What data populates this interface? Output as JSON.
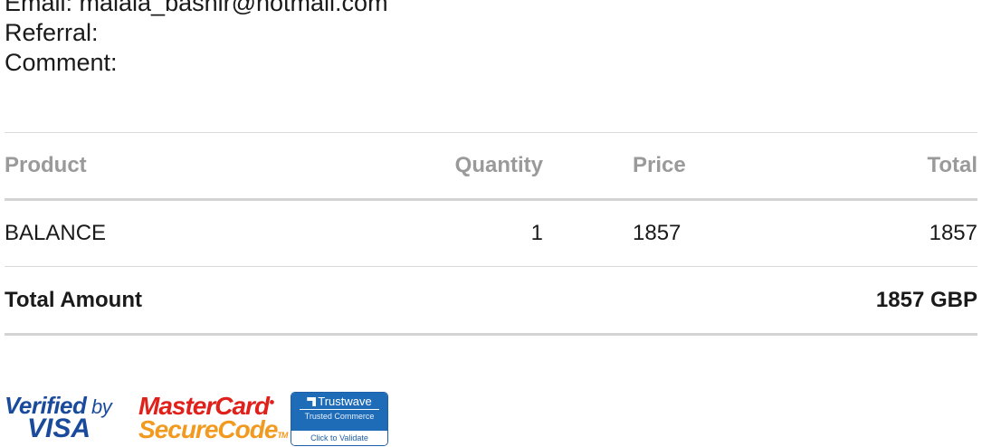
{
  "customer_info": {
    "email_line": "Email: malala_bashir@hotmail.com",
    "referral_line": "Referral:",
    "comment_line": "Comment:"
  },
  "order_table": {
    "headers": {
      "product": "Product",
      "quantity": "Quantity",
      "price": "Price",
      "total": "Total"
    },
    "rows": [
      {
        "product": "BALANCE",
        "quantity": "1",
        "price": "1857",
        "total": "1857"
      }
    ],
    "total_label": "Total Amount",
    "total_value": "1857 GBP"
  },
  "badges": {
    "visa": {
      "line1_a": "Verified",
      "line1_b": " by",
      "line2": "VISA"
    },
    "mastercard": {
      "line1": "MasterCard",
      "line2": "SecureCode"
    },
    "trustwave": {
      "brand": "Trustwave",
      "sub": "Trusted Commerce",
      "cta": "Click to Validate"
    }
  },
  "colors": {
    "header_text": "#9a9a9a",
    "visa_blue": "#1a4a9c",
    "mastercard_red": "#e0201b",
    "mastercard_orange": "#f29a1f",
    "trustwave_blue": "#1e6cb8"
  }
}
